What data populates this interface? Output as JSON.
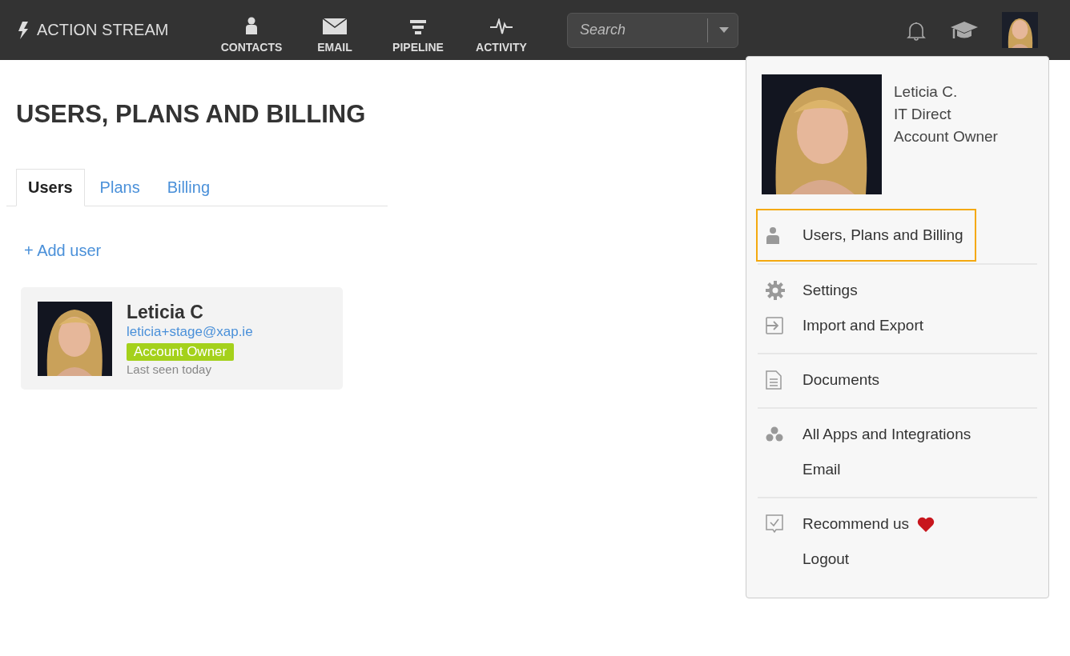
{
  "brand": "ACTION STREAM",
  "nav": [
    {
      "label": "CONTACTS",
      "kind": "contacts"
    },
    {
      "label": "EMAIL",
      "kind": "email"
    },
    {
      "label": "PIPELINE",
      "kind": "pipeline"
    },
    {
      "label": "ACTIVITY",
      "kind": "activity"
    }
  ],
  "search": {
    "placeholder": "Search"
  },
  "page_title": "USERS, PLANS AND BILLING",
  "tabs": [
    {
      "label": "Users",
      "selected": true
    },
    {
      "label": "Plans",
      "selected": false
    },
    {
      "label": "Billing",
      "selected": false
    }
  ],
  "add_user": "+ Add user",
  "users": [
    {
      "name": "Leticia C",
      "email": "leticia+stage@xap.ie",
      "role": "Account Owner",
      "last_seen": "Last seen today"
    }
  ],
  "account_menu": {
    "name": "Leticia C.",
    "company": "IT Direct",
    "role": "Account Owner",
    "groups": [
      [
        {
          "label": "Users, Plans and Billing",
          "kind": "user",
          "selected": true
        }
      ],
      [
        {
          "label": "Settings",
          "kind": "settings",
          "selected": false
        },
        {
          "label": "Import and Export",
          "kind": "import",
          "selected": false
        }
      ],
      [
        {
          "label": "Documents",
          "kind": "document",
          "selected": false
        }
      ],
      [
        {
          "label": "All Apps and Integrations",
          "kind": "apps",
          "selected": false
        },
        {
          "label": "Email",
          "kind": "plain",
          "selected": false
        }
      ],
      [
        {
          "label": "Recommend us",
          "kind": "recommend",
          "selected": false
        },
        {
          "label": "Logout",
          "kind": "plain",
          "selected": false
        }
      ]
    ]
  }
}
